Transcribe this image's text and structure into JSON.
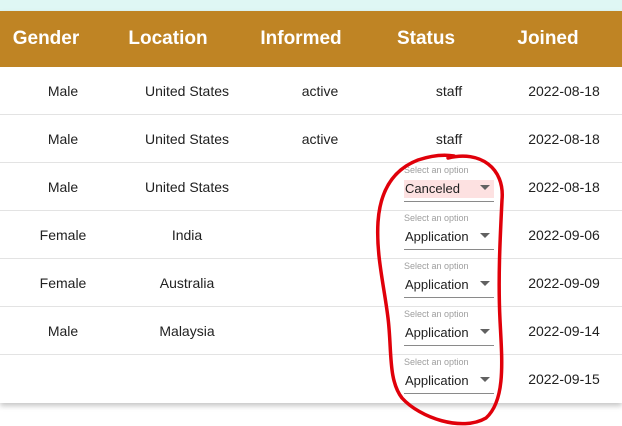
{
  "header": {
    "columns": [
      "Gender",
      "Location",
      "Informed",
      "Status",
      "Joined"
    ]
  },
  "select_label": "Select an option",
  "rows": [
    {
      "gender": "Male",
      "location": "United States",
      "informed": "active",
      "status": "staff",
      "joined": "2022-08-18"
    },
    {
      "gender": "Male",
      "location": "United States",
      "informed": "active",
      "status": "staff",
      "joined": "2022-08-18"
    },
    {
      "gender": "Male",
      "location": "United States",
      "informed": "",
      "status_select": "Canceled",
      "joined": "2022-08-18"
    },
    {
      "gender": "Female",
      "location": "India",
      "informed": "",
      "status_select": "Application",
      "joined": "2022-09-06"
    },
    {
      "gender": "Female",
      "location": "Australia",
      "informed": "",
      "status_select": "Application",
      "joined": "2022-09-09"
    },
    {
      "gender": "Male",
      "location": "Malaysia",
      "informed": "",
      "status_select": "Application",
      "joined": "2022-09-14"
    },
    {
      "gender": "",
      "location": "",
      "informed": "",
      "status_select": "Application",
      "joined": "2022-09-15"
    }
  ],
  "colors": {
    "header_bg": "#bf8424",
    "canceled_highlight": "#fde1e1",
    "annotation": "#e0000a"
  }
}
